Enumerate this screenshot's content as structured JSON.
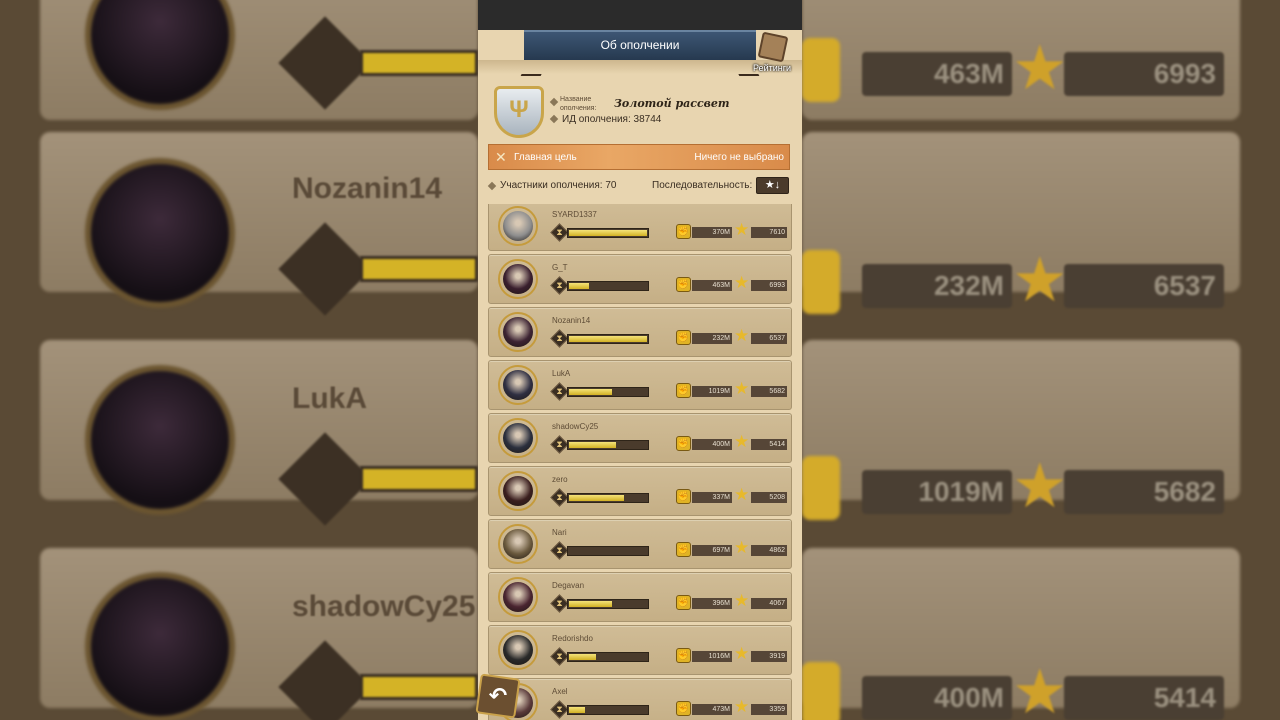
{
  "header": {
    "title": "Об ополчении",
    "rankings_label": "Рейтинги"
  },
  "guild": {
    "name_label": "Название ополчения:",
    "name": "Золотой рассвет",
    "id_text": "ИД ополчения: 38744"
  },
  "goal": {
    "label": "Главная цель",
    "value": "Ничего не выбрано"
  },
  "members": {
    "count_text": "Участники ополчения: 70",
    "order_label": "Последовательность:"
  },
  "icons": {
    "sort": "★↓",
    "back": "↶",
    "hourglass": "⧗",
    "fist": "✊",
    "star": "★"
  },
  "rows": [
    {
      "name": "SYARD1337",
      "power": "370M",
      "stars": "7610",
      "progress": 1.0,
      "avatar_color": "#8e8e8e"
    },
    {
      "name": "G_T",
      "power": "463M",
      "stars": "6993",
      "progress": 0.25,
      "avatar_color": "#3a1f2e"
    },
    {
      "name": "Nozanin14",
      "power": "232M",
      "stars": "6537",
      "progress": 1.0,
      "avatar_color": "#3d2433"
    },
    {
      "name": "LukA",
      "power": "1019M",
      "stars": "5682",
      "progress": 0.55,
      "avatar_color": "#2f2f42"
    },
    {
      "name": "shadowCy25",
      "power": "400M",
      "stars": "5414",
      "progress": 0.6,
      "avatar_color": "#2b2f3d"
    },
    {
      "name": "zero",
      "power": "337M",
      "stars": "5208",
      "progress": 0.7,
      "avatar_color": "#3b1f1f"
    },
    {
      "name": "Nari",
      "power": "697M",
      "stars": "4862",
      "progress": 0.0,
      "avatar_color": "#6b5a3e"
    },
    {
      "name": "Degavan",
      "power": "396M",
      "stars": "4067",
      "progress": 0.55,
      "avatar_color": "#4a2530"
    },
    {
      "name": "Redorishdo",
      "power": "1016M",
      "stars": "3919",
      "progress": 0.35,
      "avatar_color": "#2a2a2a"
    },
    {
      "name": "Axel",
      "power": "473M",
      "stars": "3359",
      "progress": 0.2,
      "avatar_color": "#5a3a3a"
    }
  ],
  "background": {
    "names": [
      "Nozanin14",
      "LukA",
      "shadowCy25"
    ],
    "powers": [
      "463M",
      "232M",
      "1019M",
      "400M"
    ],
    "stars": [
      "6993",
      "6537",
      "5682",
      "5414"
    ]
  }
}
